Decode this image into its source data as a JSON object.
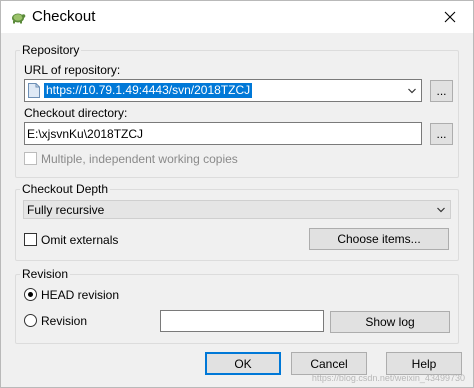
{
  "window": {
    "title": "Checkout"
  },
  "repository": {
    "legend": "Repository",
    "url_label": "URL of repository:",
    "url_value": "https://10.79.1.49:4443/svn/2018TZCJ",
    "browse_label": "...",
    "dir_label": "Checkout directory:",
    "dir_value": "E:\\xjsvnKu\\2018TZCJ",
    "dir_browse_label": "...",
    "multiple_label": "Multiple, independent working copies"
  },
  "depth": {
    "legend": "Checkout Depth",
    "selected": "Fully recursive",
    "omit_label": "Omit externals",
    "choose_items_label": "Choose items..."
  },
  "revision": {
    "legend": "Revision",
    "head_label": "HEAD revision",
    "revision_label": "Revision",
    "revision_value": "",
    "show_log_label": "Show log"
  },
  "footer": {
    "ok_label": "OK",
    "cancel_label": "Cancel",
    "help_label": "Help"
  },
  "watermark": "https://blog.csdn.net/weixin_43499730",
  "colors": {
    "accent": "#0078d7",
    "dialog_bg": "#f0f0f0"
  }
}
